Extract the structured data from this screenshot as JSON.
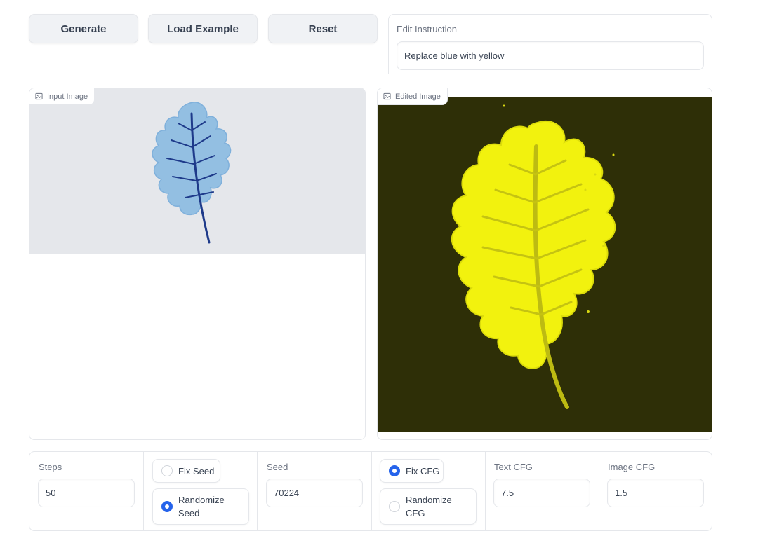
{
  "header_cut_text": "",
  "toolbar": {
    "generate_label": "Generate",
    "load_example_label": "Load Example",
    "reset_label": "Reset"
  },
  "edit_instruction": {
    "label": "Edit Instruction",
    "value": "Replace blue with yellow"
  },
  "input_image": {
    "label": "Input Image",
    "image_icon": "image-icon",
    "edit_icon": "pencil-icon",
    "clear_icon": "close-icon",
    "background": "#e5e7eb"
  },
  "edited_image": {
    "label": "Edited Image",
    "image_icon": "image-icon",
    "background": "#2e2f07",
    "leaf_color": "#f2f20e"
  },
  "settings": {
    "steps": {
      "label": "Steps",
      "value": "50"
    },
    "seed_mode": {
      "fix_label": "Fix Seed",
      "randomize_label_line1": "Randomize",
      "randomize_label_line2": "Seed",
      "selected": "Randomize Seed"
    },
    "seed": {
      "label": "Seed",
      "value": "70224"
    },
    "cfg_mode": {
      "fix_label": "Fix CFG",
      "randomize_label_line1": "Randomize",
      "randomize_label_line2": "CFG",
      "selected": "Fix CFG"
    },
    "text_cfg": {
      "label": "Text CFG",
      "value": "7.5"
    },
    "image_cfg": {
      "label": "Image CFG",
      "value": "1.5"
    }
  },
  "colors": {
    "accent": "#2563eb",
    "border": "#e5e7eb",
    "button_bg": "#f0f2f5"
  }
}
